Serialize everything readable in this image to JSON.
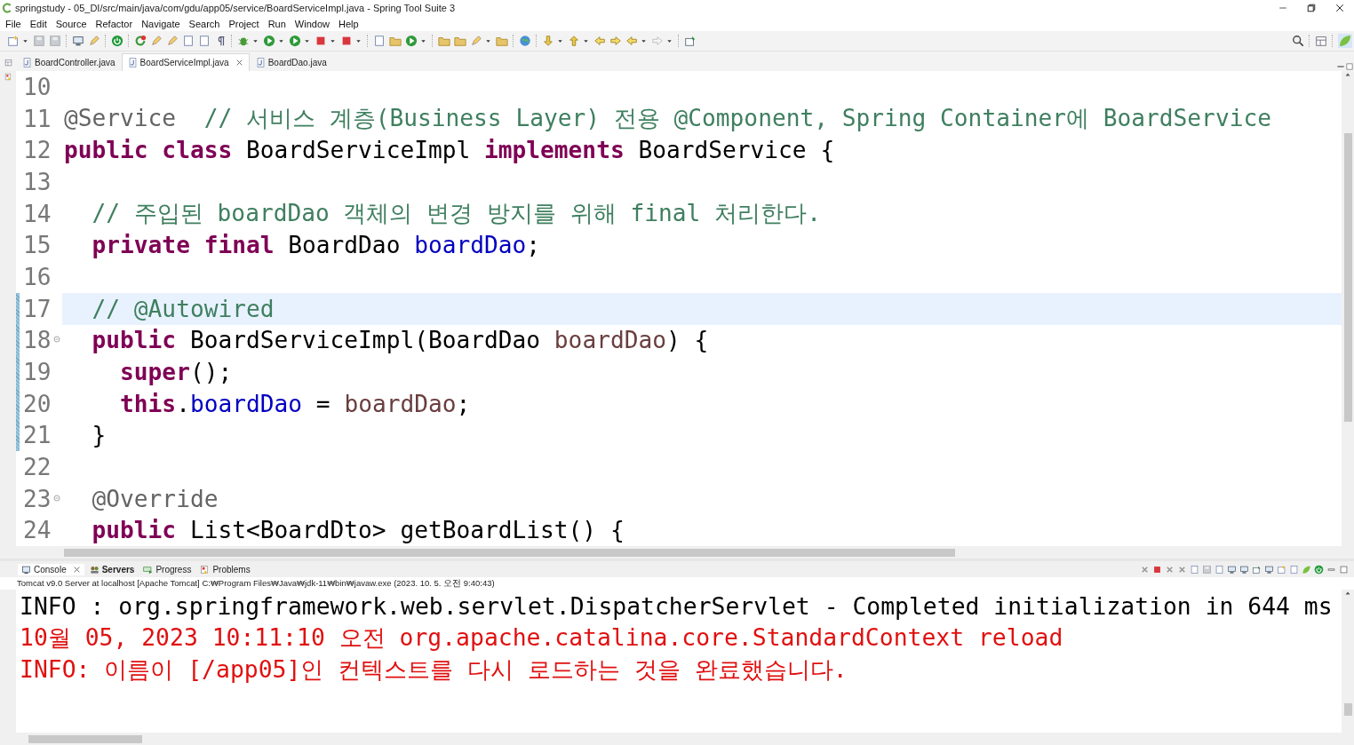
{
  "window": {
    "title": "springstudy - 05_DI/src/main/java/com/gdu/app05/service/BoardServiceImpl.java - Spring Tool Suite 3"
  },
  "menu": [
    "File",
    "Edit",
    "Source",
    "Refactor",
    "Navigate",
    "Search",
    "Project",
    "Run",
    "Window",
    "Help"
  ],
  "editor_tabs": [
    {
      "label": "BoardController.java",
      "selected": false
    },
    {
      "label": "BoardServiceImpl.java",
      "selected": true
    },
    {
      "label": "BoardDao.java",
      "selected": false
    }
  ],
  "editor": {
    "lines": [
      {
        "number": "10",
        "current": false,
        "changed": false,
        "foldable": false
      },
      {
        "number": "11",
        "current": false,
        "changed": false,
        "foldable": false,
        "tokens": [
          {
            "kind": "annotation",
            "text": "@Service"
          },
          {
            "kind": "comment",
            "text": "  // 서비스 계층(Business Layer) 전용 @Component, Spring Container에 BoardService"
          }
        ]
      },
      {
        "number": "12",
        "current": false,
        "changed": false,
        "foldable": false,
        "tokens": [
          {
            "kind": "keyword",
            "text": "public class"
          },
          {
            "kind": "plain",
            "text": " BoardServiceImpl "
          },
          {
            "kind": "keyword",
            "text": "implements"
          },
          {
            "kind": "plain",
            "text": " BoardService {"
          }
        ]
      },
      {
        "number": "13",
        "current": false,
        "changed": false,
        "foldable": false
      },
      {
        "number": "14",
        "current": false,
        "changed": false,
        "foldable": false,
        "tokens": [
          {
            "kind": "comment",
            "text": "  // 주입된 boardDao 객체의 변경 방지를 위해 final 처리한다."
          }
        ]
      },
      {
        "number": "15",
        "current": false,
        "changed": false,
        "foldable": false,
        "tokens": [
          {
            "kind": "keyword",
            "text": "  private final"
          },
          {
            "kind": "plain",
            "text": " BoardDao "
          },
          {
            "kind": "field",
            "text": "boardDao"
          },
          {
            "kind": "plain",
            "text": ";"
          }
        ]
      },
      {
        "number": "16",
        "current": false,
        "changed": false,
        "foldable": false
      },
      {
        "number": "17",
        "current": true,
        "changed": true,
        "foldable": false,
        "tokens": [
          {
            "kind": "comment",
            "text": "  // @Autowired"
          }
        ]
      },
      {
        "number": "18",
        "current": false,
        "changed": true,
        "foldable": true,
        "tokens": [
          {
            "kind": "keyword",
            "text": "  public"
          },
          {
            "kind": "plain",
            "text": " BoardServiceImpl(BoardDao "
          },
          {
            "kind": "param",
            "text": "boardDao"
          },
          {
            "kind": "plain",
            "text": ") {"
          }
        ]
      },
      {
        "number": "19",
        "current": false,
        "changed": true,
        "foldable": false,
        "tokens": [
          {
            "kind": "keyword",
            "text": "    super"
          },
          {
            "kind": "plain",
            "text": "();"
          }
        ]
      },
      {
        "number": "20",
        "current": false,
        "changed": true,
        "foldable": false,
        "tokens": [
          {
            "kind": "keyword",
            "text": "    this"
          },
          {
            "kind": "plain",
            "text": "."
          },
          {
            "kind": "field",
            "text": "boardDao"
          },
          {
            "kind": "plain",
            "text": " = "
          },
          {
            "kind": "param",
            "text": "boardDao"
          },
          {
            "kind": "plain",
            "text": ";"
          }
        ]
      },
      {
        "number": "21",
        "current": false,
        "changed": true,
        "foldable": false,
        "tokens": [
          {
            "kind": "plain",
            "text": "  }"
          }
        ]
      },
      {
        "number": "22",
        "current": false,
        "changed": false,
        "foldable": false
      },
      {
        "number": "23",
        "current": false,
        "changed": false,
        "foldable": true,
        "tokens": [
          {
            "kind": "annotation",
            "text": "  @Override"
          }
        ]
      },
      {
        "number": "24",
        "current": false,
        "changed": false,
        "foldable": false,
        "tokens": [
          {
            "kind": "keyword",
            "text": "  public"
          },
          {
            "kind": "plain",
            "text": " List<BoardDto> getBoardList() {"
          }
        ]
      }
    ]
  },
  "console_tabs": [
    {
      "label": "Console",
      "selected": true,
      "bold": false
    },
    {
      "label": "Servers",
      "selected": false,
      "bold": true
    },
    {
      "label": "Progress",
      "selected": false,
      "bold": false
    },
    {
      "label": "Problems",
      "selected": false,
      "bold": false
    }
  ],
  "console": {
    "description": "Tomcat v9.0 Server at localhost [Apache Tomcat] C:₩Program Files₩Java₩jdk-11₩bin₩javaw.exe  (2023. 10. 5. 오전 9:40:43)",
    "lines": [
      {
        "color": "#000000",
        "text": "INFO : org.springframework.web.servlet.DispatcherServlet - Completed initialization in 644 ms"
      },
      {
        "color": "#e01010",
        "text": "10월 05, 2023 10:11:10 오전 org.apache.catalina.core.StandardContext reload"
      },
      {
        "color": "#e01010",
        "text": "INFO: 이름이 [/app05]인 컨텍스트를 다시 로드하는 것을 완료했습니다."
      }
    ]
  }
}
